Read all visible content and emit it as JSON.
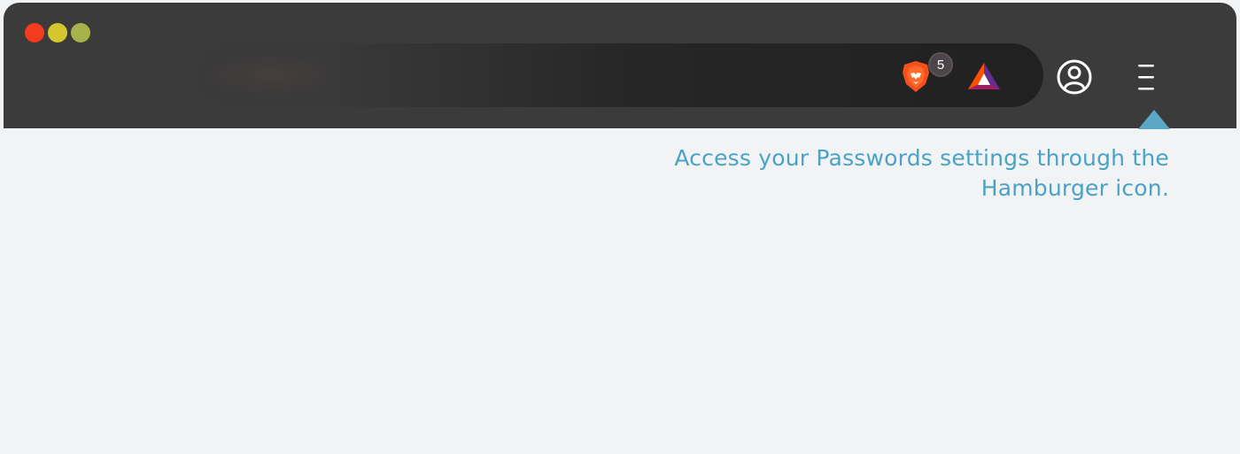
{
  "browser": {
    "window_controls": [
      {
        "name": "close",
        "color": "#f23b1f"
      },
      {
        "name": "minimize",
        "color": "#d6c62d"
      },
      {
        "name": "zoom",
        "color": "#a8b24a"
      }
    ],
    "toolbar": {
      "shield_badge_count": "5",
      "icons": [
        "brave-shield-icon",
        "bat-rewards-icon",
        "profile-icon",
        "menu-icon"
      ]
    }
  },
  "tooltip": {
    "text": "Access your Passwords settings through the Hamburger icon."
  },
  "colors": {
    "frame": "#3b3b3b",
    "address_bar": "#262626",
    "page_background": "#f2f3f4",
    "tooltip_text": "#4aa3c7",
    "tooltip_arrow": "#5aa8c6"
  }
}
